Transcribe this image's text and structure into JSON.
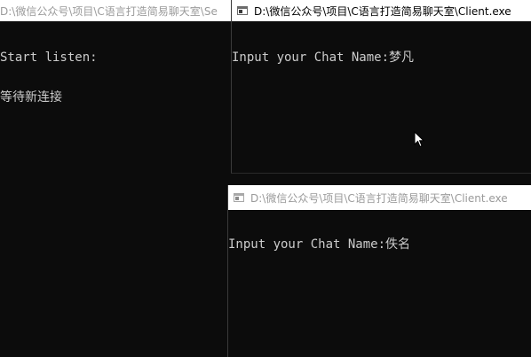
{
  "server": {
    "title": "D:\\微信公众号\\项目\\C语言打造简易聊天室\\Se",
    "lines": [
      "Start listen:",
      "等待新连接"
    ]
  },
  "client1": {
    "title": "D:\\微信公众号\\项目\\C语言打造简易聊天室\\Client.exe",
    "prompt": "Input your Chat Name:",
    "input_value": "梦凡"
  },
  "client2": {
    "title": "D:\\微信公众号\\项目\\C语言打造简易聊天室\\Client.exe",
    "prompt": "Input your Chat Name:",
    "input_value": "佚名"
  },
  "icons": {
    "console": "console-window-icon",
    "cursor": "mouse-pointer-icon"
  },
  "colors": {
    "console_bg": "#0c0c0c",
    "console_text": "#cccccc",
    "active_title": "#000000",
    "inactive_title": "#9a9a9a"
  }
}
